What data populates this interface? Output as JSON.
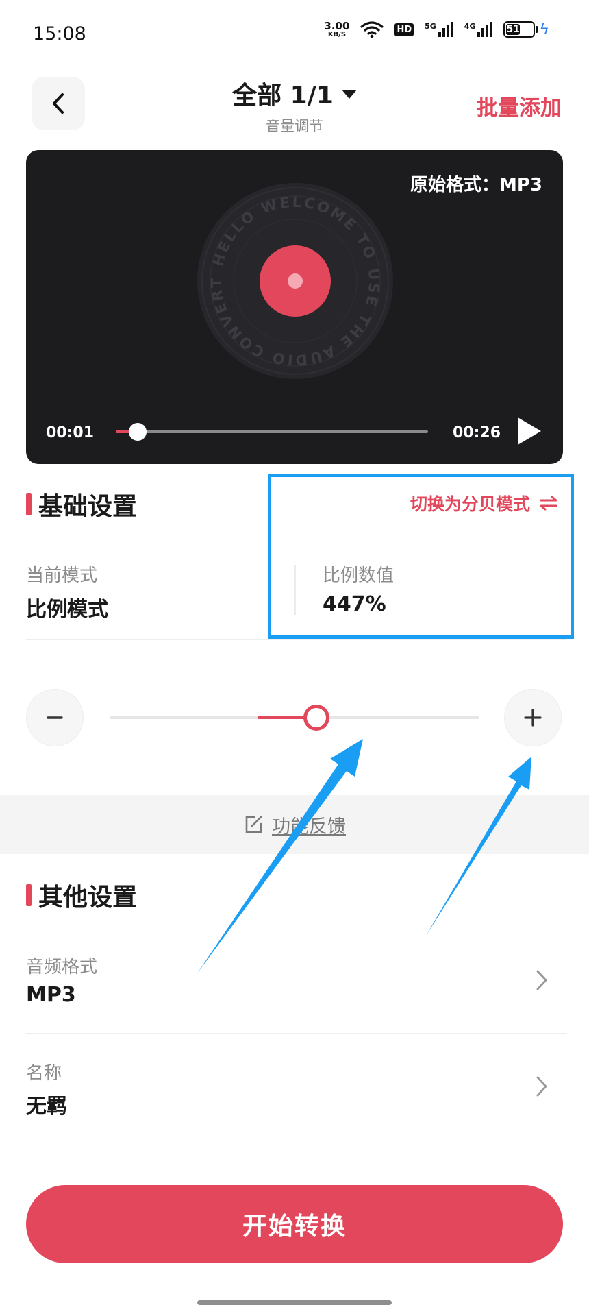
{
  "status_bar": {
    "time": "15:08",
    "net_speed_value": "3.00",
    "net_speed_unit": "KB/S",
    "hd_label": "HD",
    "signal1_tag": "5G",
    "signal2_tag": "4G",
    "battery_level": "51"
  },
  "header": {
    "title": "全部 1/1",
    "subtitle": "音量调节",
    "batch_add_label": "批量添加"
  },
  "player": {
    "original_format": "原始格式：MP3",
    "disc_text": "HELLO WELCOME TO USE THE AUDIO CONVERTER",
    "current_time": "00:01",
    "total_time": "00:26",
    "progress_fraction": 0.07
  },
  "basic_settings": {
    "title": "基础设置",
    "switch_mode_label": "切换为分贝模式",
    "current_mode_label": "当前模式",
    "current_mode_value": "比例模式",
    "ratio_label": "比例数值",
    "ratio_value": "447%",
    "slider_fraction": 0.56
  },
  "feedback": {
    "label": "功能反馈"
  },
  "other_settings": {
    "title": "其他设置",
    "audio_format_label": "音频格式",
    "audio_format_value": "MP3",
    "name_label": "名称",
    "name_value": "无羁"
  },
  "start_button_label": "开始转换",
  "colors": {
    "accent": "#e2475b",
    "highlight": "#1a9ef3",
    "player_bg": "#1c1c1f"
  }
}
